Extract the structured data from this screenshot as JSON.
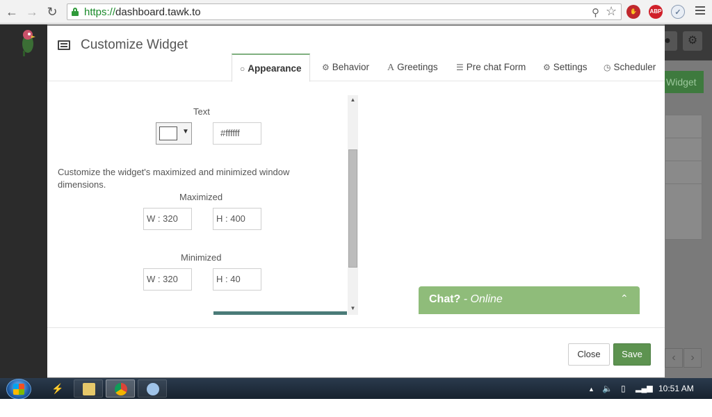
{
  "browser": {
    "url_scheme": "https://",
    "url_host": "dashboard.tawk.to",
    "back_icon": "back-arrow-icon",
    "forward_icon": "forward-arrow-icon",
    "reload_icon": "reload-icon",
    "extensions": [
      {
        "name": "adblock-stop-icon",
        "label": "",
        "color": "#c0282d"
      },
      {
        "name": "abp-icon",
        "label": "ABP",
        "color": "#d0202a"
      },
      {
        "name": "shield-icon",
        "label": "",
        "color": "#6a7f9a"
      }
    ]
  },
  "background_app": {
    "widget_button": "Widget"
  },
  "modal": {
    "title": "Customize Widget",
    "tabs": [
      {
        "label": "Appearance",
        "icon": "spinner-circle-icon",
        "active": true
      },
      {
        "label": "Behavior",
        "icon": "gears-icon"
      },
      {
        "label": "Greetings",
        "icon": "font-a-icon"
      },
      {
        "label": "Pre chat Form",
        "icon": "list-icon"
      },
      {
        "label": "Settings",
        "icon": "gear-icon"
      },
      {
        "label": "Scheduler",
        "icon": "clock-icon"
      }
    ],
    "text_color": {
      "label": "Text",
      "value": "#ffffff",
      "swatch_color": "#ffffff"
    },
    "dimensions_description": "Customize the widget's maximized and minimized window dimensions.",
    "maximized": {
      "label": "Maximized",
      "width": "W :  320",
      "height": "H :  400"
    },
    "minimized": {
      "label": "Minimized",
      "width": "W :  320",
      "height": "H :  40"
    },
    "preview": {
      "title": "Chat?",
      "separator": " - ",
      "status": "Online",
      "color": "#8fbc7a"
    },
    "footer": {
      "close_label": "Close",
      "save_label": "Save"
    }
  },
  "taskbar": {
    "clock": "10:51 AM"
  }
}
